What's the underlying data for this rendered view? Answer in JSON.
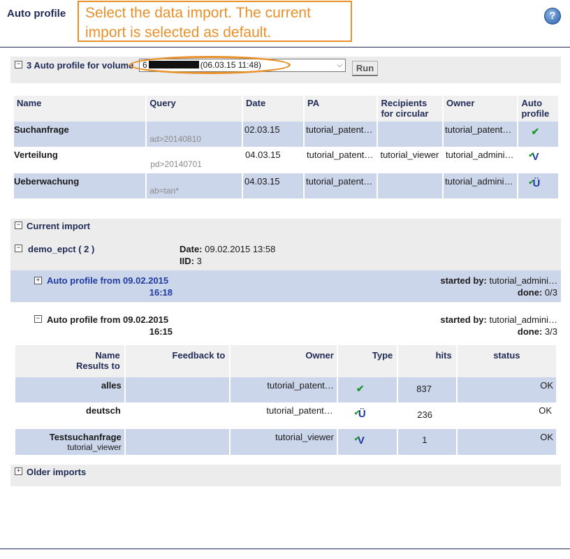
{
  "header": {
    "title": "Auto profile",
    "callout": "Select the data import. The current import is selected as default.",
    "help_icon": "help-icon"
  },
  "volume": {
    "label": "3 Auto profile for volume",
    "select_prefix": "6",
    "select_suffix": "(06.03.15 11:48)",
    "run_label": "Run"
  },
  "profiles": {
    "headers": [
      "Name",
      "Query",
      "Date",
      "PA",
      "Recipients for circular",
      "Owner",
      "Auto profile"
    ],
    "rows": [
      {
        "name": "Suchanfrage",
        "query": "ad>20140810",
        "date": "02.03.15",
        "pa": "tutorial_patent…",
        "recipients": "",
        "owner": "tutorial_patent…",
        "icon": "check-icon"
      },
      {
        "name": "Verteilung",
        "query": "pd>20140701",
        "date": "04.03.15",
        "pa": "tutorial_patent…",
        "recipients": "tutorial_viewer",
        "owner": "tutorial_admini…",
        "icon": "v-icon"
      },
      {
        "name": "Ueberwachung",
        "query": "ab=tan*",
        "date": "04.03.15",
        "pa": "tutorial_patent…",
        "recipients": "",
        "owner": "tutorial_admini…",
        "icon": "u-icon"
      }
    ]
  },
  "current_import": {
    "label": "Current import",
    "import_name": "demo_epct ( 2 )",
    "date_label": "Date:",
    "date_value": "09.02.2015 13:58",
    "iid_label": "IID:",
    "iid_value": "3",
    "runs": [
      {
        "title_line1": "Auto profile from 09.02.2015",
        "title_line2": "16:18",
        "started_label": "started by:",
        "started_value": "tutorial_admini…",
        "done_label": "done:",
        "done_value": "0/3"
      },
      {
        "title_line1": "Auto profile from 09.02.2015",
        "title_line2": "16:15",
        "started_label": "started by:",
        "started_value": "tutorial_admini…",
        "done_label": "done:",
        "done_value": "3/3"
      }
    ]
  },
  "results": {
    "headers": {
      "name": "Name",
      "results_to": "Results to",
      "feedback": "Feedback to",
      "owner": "Owner",
      "type": "Type",
      "hits": "hits",
      "status": "status"
    },
    "rows": [
      {
        "name": "alles",
        "sub": "",
        "owner": "tutorial_patent…",
        "icon": "check-icon",
        "hits": "837",
        "status": "OK"
      },
      {
        "name": "deutsch",
        "sub": "",
        "owner": "tutorial_patent…",
        "icon": "u-icon",
        "hits": "236",
        "status": "OK"
      },
      {
        "name": "Testsuchanfrage",
        "sub": "tutorial_viewer",
        "owner": "tutorial_viewer",
        "icon": "v-icon",
        "hits": "1",
        "status": "OK"
      }
    ]
  },
  "older": {
    "label": "Older imports"
  },
  "colors": {
    "accent_orange": "#e8902a",
    "navy": "#1f2a56",
    "row_blue": "#ccd6ea",
    "panel_gray": "#ececec"
  }
}
